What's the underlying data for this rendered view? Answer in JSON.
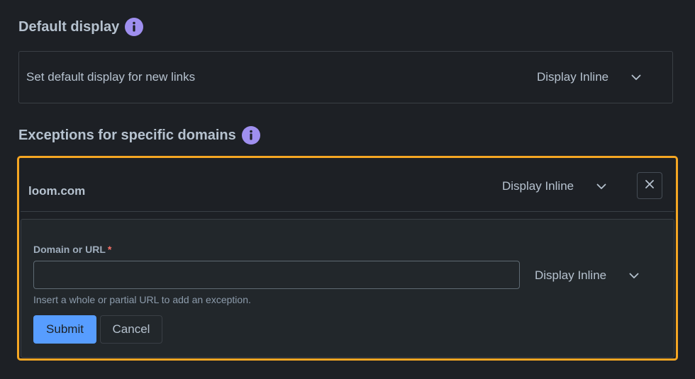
{
  "default_display": {
    "heading": "Default display",
    "info_icon": "info-icon",
    "row_label": "Set default display for new links",
    "select_value": "Display Inline"
  },
  "exceptions": {
    "heading": "Exceptions for specific domains",
    "info_icon": "info-icon",
    "items": [
      {
        "domain": "loom.com",
        "select_value": "Display Inline",
        "remove_icon": "close-icon"
      }
    ],
    "form": {
      "field_label": "Domain or URL",
      "required_mark": "*",
      "input_value": "",
      "select_value": "Display Inline",
      "helper_text": "Insert a whole or partial URL to add an exception.",
      "submit_label": "Submit",
      "cancel_label": "Cancel"
    }
  },
  "colors": {
    "background": "#1d2025",
    "info_icon": "#9f8fef",
    "focus_outline": "#f5a623",
    "primary_button": "#579dff",
    "required": "#f87168"
  }
}
